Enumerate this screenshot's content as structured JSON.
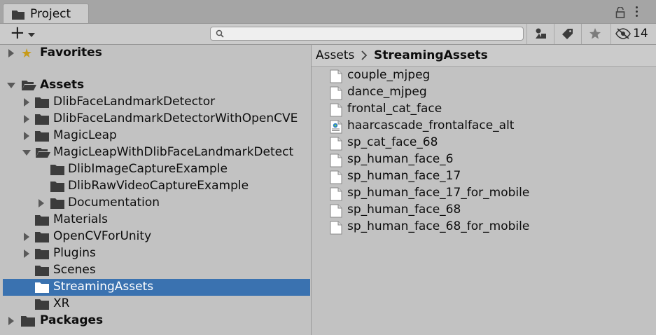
{
  "tab": {
    "title": "Project",
    "icon": "folder-icon"
  },
  "toolbar": {
    "create_label": "+",
    "search_value": "",
    "search_placeholder": "",
    "hidden_count": "14"
  },
  "tree": {
    "favorites": "Favorites",
    "assets": "Assets",
    "items": [
      "DlibFaceLandmarkDetector",
      "DlibFaceLandmarkDetectorWithOpenCVE",
      "MagicLeap",
      "MagicLeapWithDlibFaceLandmarkDetect",
      "DlibImageCaptureExample",
      "DlibRawVideoCaptureExample",
      "Documentation",
      "Materials",
      "OpenCVForUnity",
      "Plugins",
      "Scenes",
      "StreamingAssets",
      "XR"
    ],
    "packages": "Packages"
  },
  "breadcrumb": {
    "root": "Assets",
    "current": "StreamingAssets"
  },
  "files": [
    "couple_mjpeg",
    "dance_mjpeg",
    "frontal_cat_face",
    "haarcascade_frontalface_alt",
    "sp_cat_face_68",
    "sp_human_face_6",
    "sp_human_face_17",
    "sp_human_face_17_for_mobile",
    "sp_human_face_68",
    "sp_human_face_68_for_mobile"
  ],
  "colors": {
    "selection": "#3a72b0",
    "panel": "#c2c2c2",
    "header": "#cbcbcb"
  }
}
